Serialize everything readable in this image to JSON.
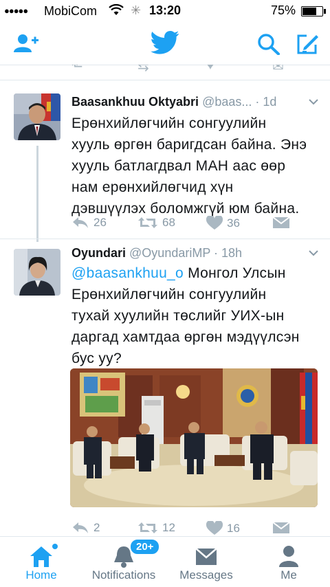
{
  "status_bar": {
    "signal": "●●●●●",
    "carrier": "MobiCom",
    "time": "13:20",
    "battery": "75%",
    "battery_level": 0.75
  },
  "nav": {
    "icons": [
      "add-user-icon",
      "twitter-bird-icon",
      "search-icon",
      "compose-icon"
    ]
  },
  "tweets": [
    {
      "name": "Baasankhuu Oktyabri",
      "handle": "@baas...",
      "time": "· 1d",
      "lines": [
        "Ерөнхийлөгчийн сонгуулийн",
        "хууль өргөн баригдсан байна. Энэ",
        "хууль батлагдвал МАН аас өөр",
        "нам ерөнхийлөгчид хүн",
        "дэвшүүлэх боломжгүй юм байна."
      ],
      "replies": "26",
      "retweets": "68",
      "likes": "36"
    },
    {
      "name": "Oyundari",
      "handle": "@OyundariMP",
      "time": "· 18h",
      "mention": "@baasankhuu_o",
      "first_line_rest": " Монгол Улсын",
      "lines": [
        "Ерөнхийлөгчийн сонгуулийн",
        "тухай хуулийн төслийг УИХ-ын",
        "даргад хамтдаа өргөн мэдүүлсэн",
        "бус уу?"
      ],
      "replies": "2",
      "retweets": "12",
      "likes": "16"
    }
  ],
  "tabs": [
    {
      "label": "Home",
      "icon": "home-icon",
      "active": true
    },
    {
      "label": "Notifications",
      "icon": "bell-icon",
      "badge": "20+"
    },
    {
      "label": "Messages",
      "icon": "envelope-icon"
    },
    {
      "label": "Me",
      "icon": "person-icon"
    }
  ],
  "colors": {
    "accent": "#1da1f2",
    "muted": "#8899a6",
    "text": "#14171a"
  }
}
